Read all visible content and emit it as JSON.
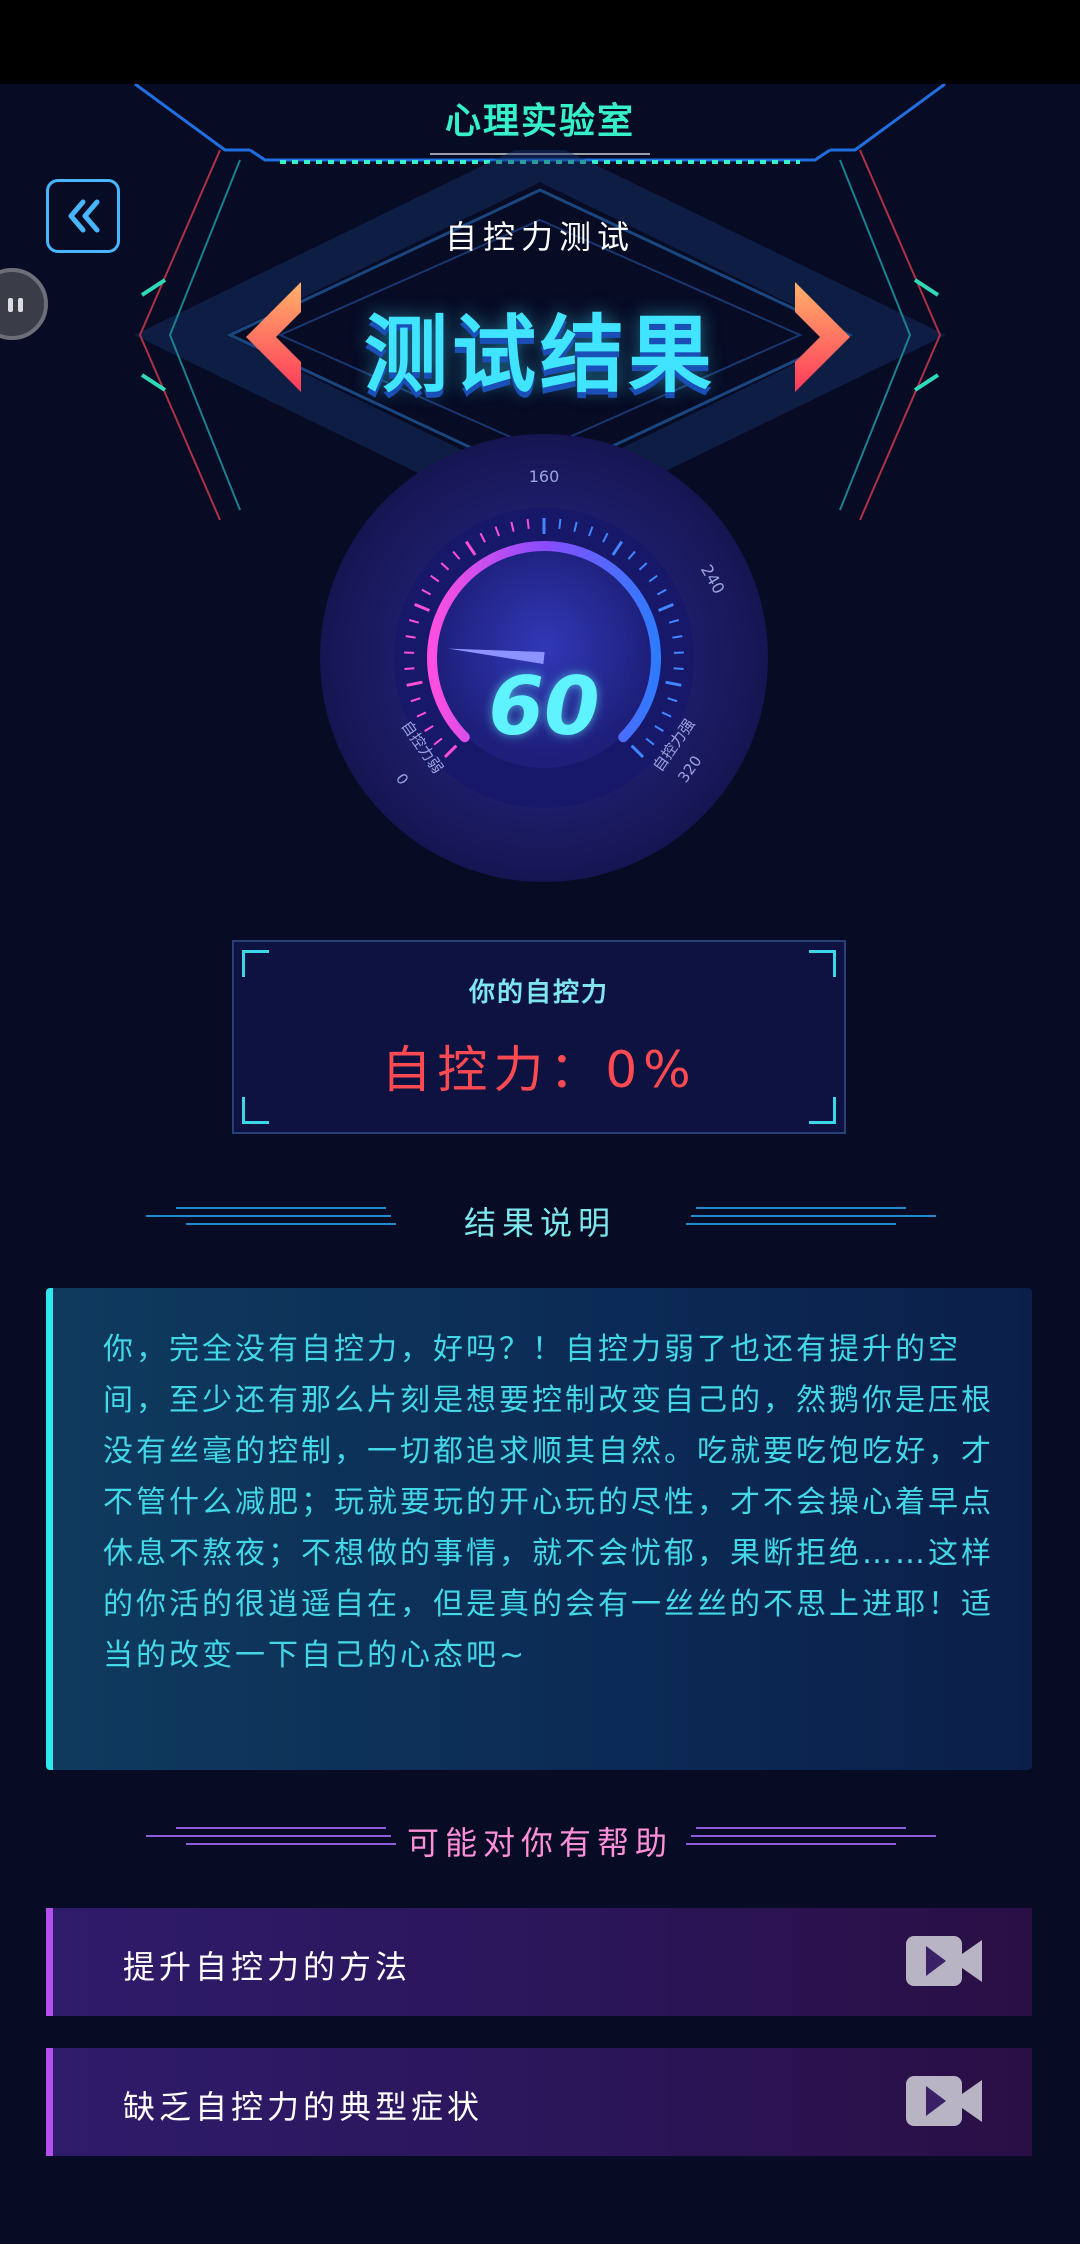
{
  "header": {
    "app_title": "心理实验室",
    "subtitle": "自控力测试",
    "result_title": "测试结果"
  },
  "gauge": {
    "value": "60",
    "min_label": "0",
    "min_caption": "自控力弱",
    "top_label": "160",
    "right_label": "240",
    "max_label": "320",
    "max_caption": "自控力强"
  },
  "score_box": {
    "label": "你的自控力",
    "value": "自控力：0%"
  },
  "result_section": {
    "heading": "结果说明",
    "text": "你，完全没有自控力，好吗？！自控力弱了也还有提升的空间，至少还有那么片刻是想要控制改变自己的，然鹅你是压根没有丝毫的控制，一切都追求顺其自然。吃就要吃饱吃好，才不管什么减肥；玩就要玩的开心玩的尽性，才不会操心着早点休息不熬夜；不想做的事情，就不会忧郁，果断拒绝……这样的你活的很逍遥自在，但是真的会有一丝丝的不思上进耶！适当的改变一下自己的心态吧~"
  },
  "help_section": {
    "heading": "可能对你有帮助",
    "items": [
      {
        "label": "提升自控力的方法",
        "icon": "video-icon"
      },
      {
        "label": "缺乏自控力的典型症状",
        "icon": "video-icon"
      }
    ]
  },
  "colors": {
    "background": "#070b24",
    "accent_cyan": "#40e4ff",
    "score_red": "#ff4a52",
    "help_purple": "#b34ef0"
  }
}
